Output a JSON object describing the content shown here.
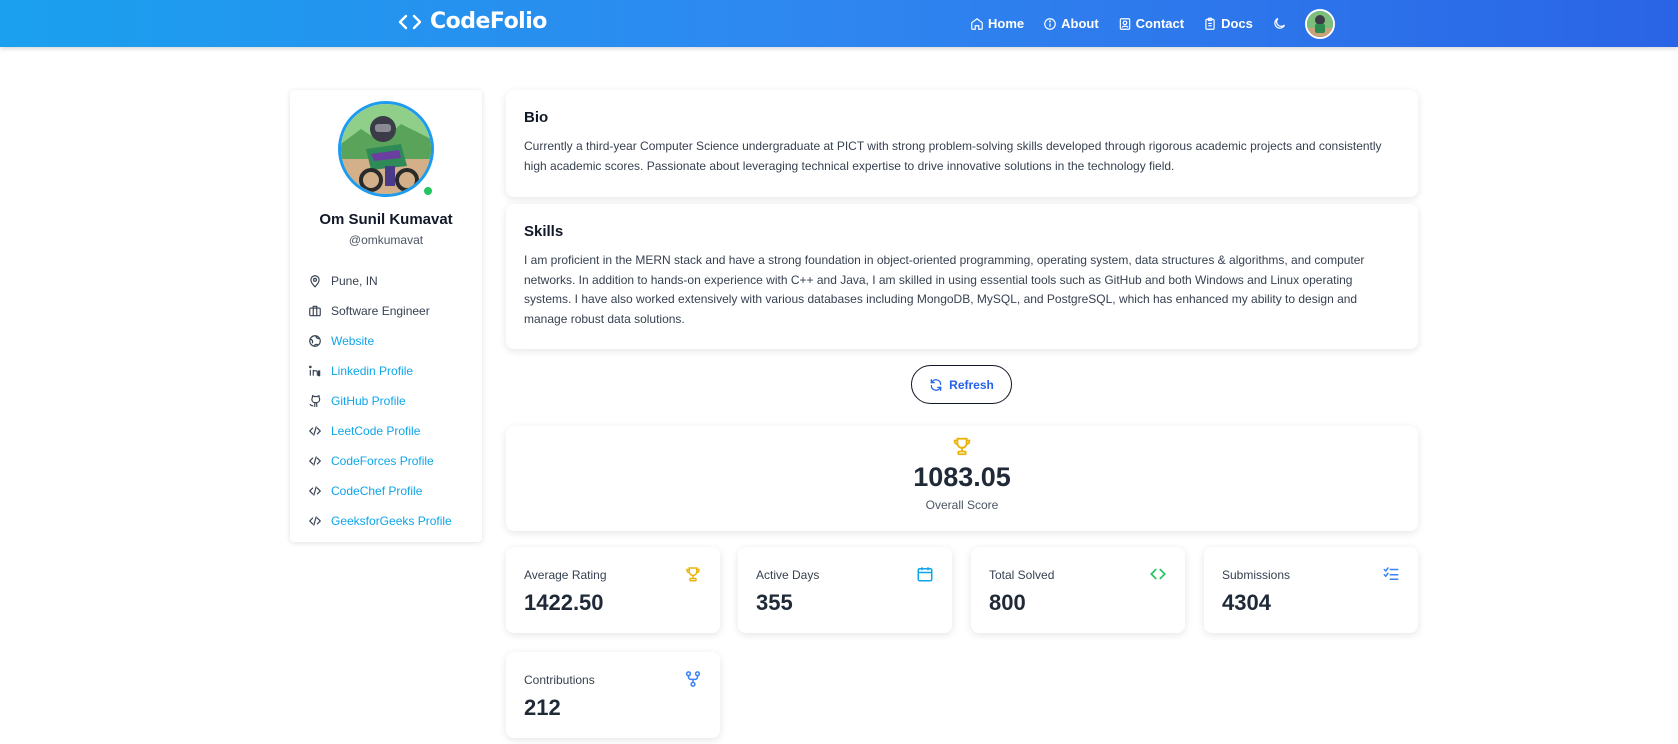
{
  "navbar": {
    "brand": "CodeFolio",
    "links": [
      "Home",
      "About",
      "Contact",
      "Docs"
    ]
  },
  "profile": {
    "name": "Om Sunil Kumavat",
    "handle": "@omkumavat",
    "location": "Pune, IN",
    "role": "Software Engineer",
    "links": [
      "Website",
      "Linkedin Profile",
      "GitHub Profile",
      "LeetCode Profile",
      "CodeForces Profile",
      "CodeChef Profile",
      "GeeksforGeeks Profile"
    ]
  },
  "bio": {
    "title": "Bio",
    "text": "Currently a third-year Computer Science undergraduate at PICT with strong problem-solving skills developed through rigorous academic projects and consistently high academic scores. Passionate about leveraging technical expertise to drive innovative solutions in the technology field."
  },
  "skills": {
    "title": "Skills",
    "text": "I am proficient in the MERN stack and have a strong foundation in object-oriented programming, operating system, data structures & algorithms, and computer networks. In addition to hands-on experience with C++ and Java, I am skilled in using essential tools such as GitHub and both Windows and Linux operating systems. I have also worked extensively with various databases including MongoDB, MySQL, and PostgreSQL, which has enhanced my ability to design and manage robust data solutions."
  },
  "refresh_label": "Refresh",
  "overall": {
    "value": "1083.05",
    "label": "Overall Score"
  },
  "stats": [
    {
      "label": "Average Rating",
      "value": "1422.50",
      "icon": "trophy-icon",
      "color": "#eab308"
    },
    {
      "label": "Active Days",
      "value": "355",
      "icon": "calendar-icon",
      "color": "#0ea5e9"
    },
    {
      "label": "Total Solved",
      "value": "800",
      "icon": "code-icon",
      "color": "#22c55e"
    },
    {
      "label": "Submissions",
      "value": "4304",
      "icon": "list-check-icon",
      "color": "#3b82f6"
    },
    {
      "label": "Contributions",
      "value": "212",
      "icon": "git-fork-icon",
      "color": "#3b82f6"
    }
  ],
  "colors": {
    "accent": "#2f86f0",
    "link": "#0ea5e9",
    "online": "#22c55e"
  }
}
